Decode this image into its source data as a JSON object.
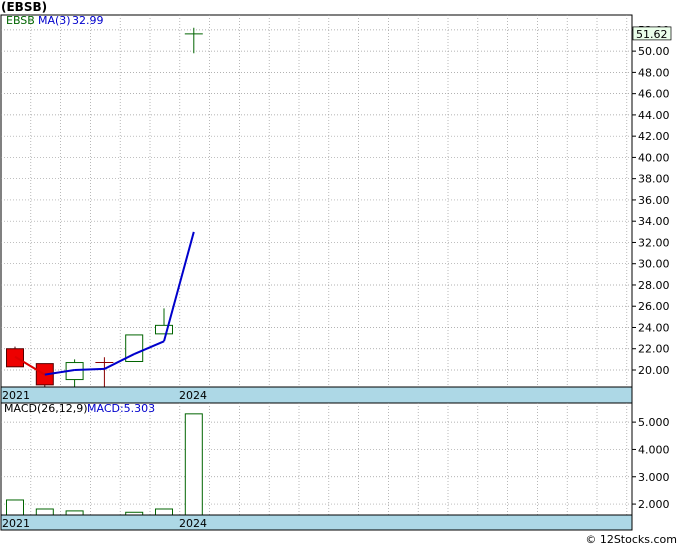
{
  "title": "(EBSB)",
  "watermark": "© 12Stocks.com",
  "colors": {
    "frame": "#000000",
    "grid": "#999999",
    "axis_band": "#add8e6",
    "up_body": "#ffffff",
    "up_border": "#006400",
    "down_body": "#ee0000",
    "ma_down": "#dd0000",
    "ma_up": "#0000cc",
    "price_badge": "#eaffea"
  },
  "chart_data": [
    {
      "type": "candlestick",
      "legend": {
        "symbol": "EBSB",
        "ma_label": "MA(3)",
        "ma_value": "32.99"
      },
      "last_price": "51.62",
      "x_tick_labels": [
        "2021",
        "2024"
      ],
      "ylim": [
        18.4,
        53.4
      ],
      "y_tick_labels": [
        "52.00",
        "50.00",
        "48.00",
        "46.00",
        "44.00",
        "42.00",
        "40.00",
        "38.00",
        "36.00",
        "34.00",
        "32.00",
        "30.00",
        "28.00",
        "26.00",
        "24.00",
        "22.00",
        "20.00"
      ],
      "candles": [
        {
          "open": 22.0,
          "close": 20.3,
          "high": 22.2,
          "low": 20.3
        },
        {
          "open": 20.6,
          "close": 18.6,
          "high": 20.6,
          "low": 18.2
        },
        {
          "open": 19.1,
          "close": 20.7,
          "high": 21.0,
          "low": 18.4
        },
        {
          "open": 20.7,
          "close": 20.7,
          "high": 21.2,
          "low": 18.4
        },
        {
          "open": 20.8,
          "close": 23.3,
          "high": 23.3,
          "low": 20.8
        },
        {
          "open": 23.4,
          "close": 24.2,
          "high": 25.8,
          "low": 23.4
        },
        {
          "open": 51.62,
          "close": 51.62,
          "high": 52.2,
          "low": 49.8
        }
      ],
      "ma": [
        null,
        null,
        20.0,
        20.1,
        21.5,
        22.7,
        32.99
      ]
    },
    {
      "type": "bar",
      "legend": {
        "label": "MACD(26,12,9)",
        "value_label": "MACD:5.303"
      },
      "x_tick_labels": [
        "2021",
        "2024"
      ],
      "ylim": [
        1.6,
        5.7
      ],
      "y_tick_labels": [
        "5.000",
        "4.000",
        "3.000",
        "2.000"
      ],
      "values": [
        2.15,
        1.82,
        1.75,
        null,
        1.7,
        1.82,
        5.303
      ]
    }
  ]
}
